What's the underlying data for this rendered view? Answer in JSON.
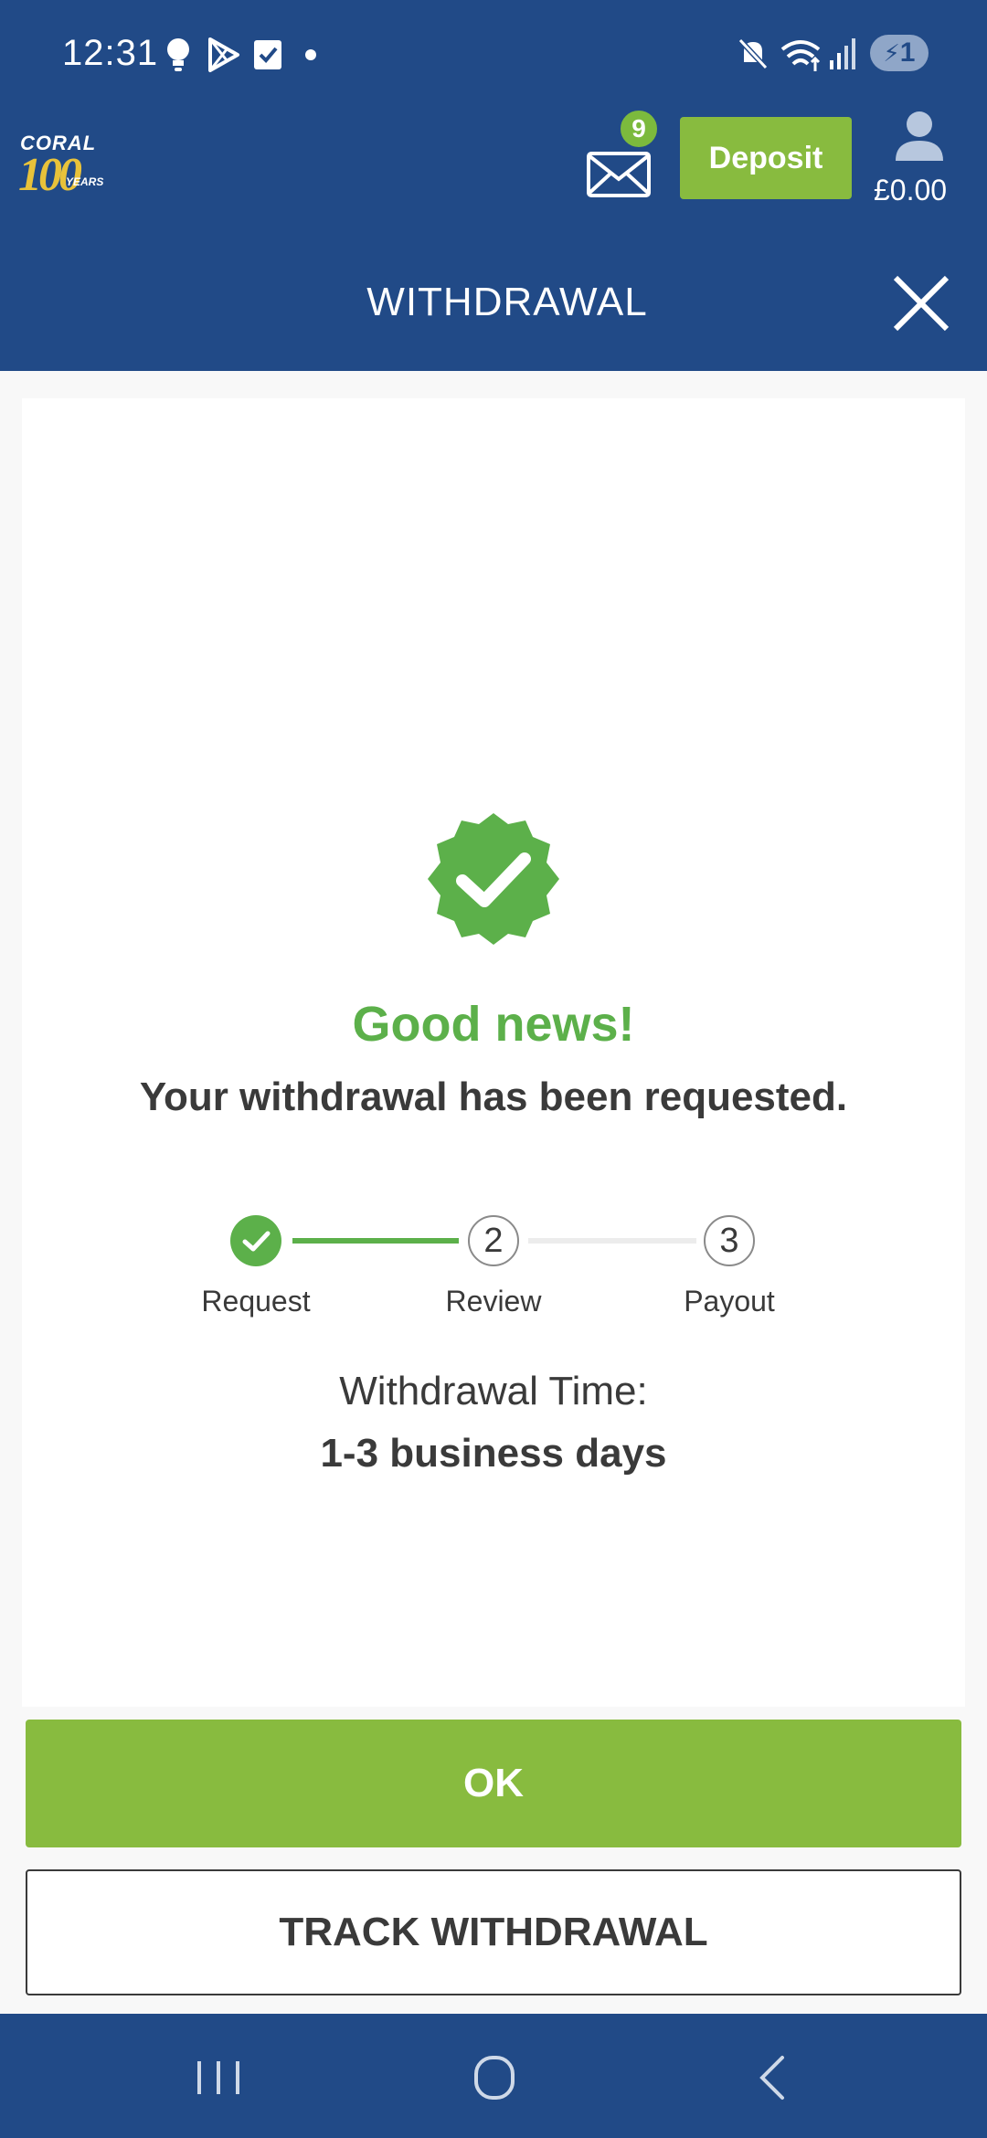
{
  "status_bar": {
    "time": "12:31",
    "battery_text": "1",
    "icons": [
      "bulb-icon",
      "play-store-icon",
      "checkbox-icon",
      "dot-icon",
      "mute-icon",
      "wifi-icon",
      "signal-icon",
      "battery-icon"
    ]
  },
  "header": {
    "logo_brand": "CORAL",
    "logo_number": "100",
    "logo_years": "YEARS",
    "messages_count": "9",
    "deposit_label": "Deposit",
    "balance": "£0.00"
  },
  "titlebar": {
    "title": "WITHDRAWAL"
  },
  "confirmation": {
    "heading": "Good news!",
    "message": "Your withdrawal has been requested.",
    "steps": [
      {
        "number": "1",
        "label": "Request",
        "state": "done"
      },
      {
        "number": "2",
        "label": "Review",
        "state": "pending"
      },
      {
        "number": "3",
        "label": "Payout",
        "state": "pending"
      }
    ],
    "time_label": "Withdrawal Time:",
    "time_value": "1-3 business days"
  },
  "actions": {
    "ok_label": "OK",
    "track_label": "TRACK WITHDRAWAL"
  },
  "colors": {
    "brand_blue": "#214a87",
    "accent_green": "#88bb3f",
    "success_green": "#5cb04a"
  }
}
